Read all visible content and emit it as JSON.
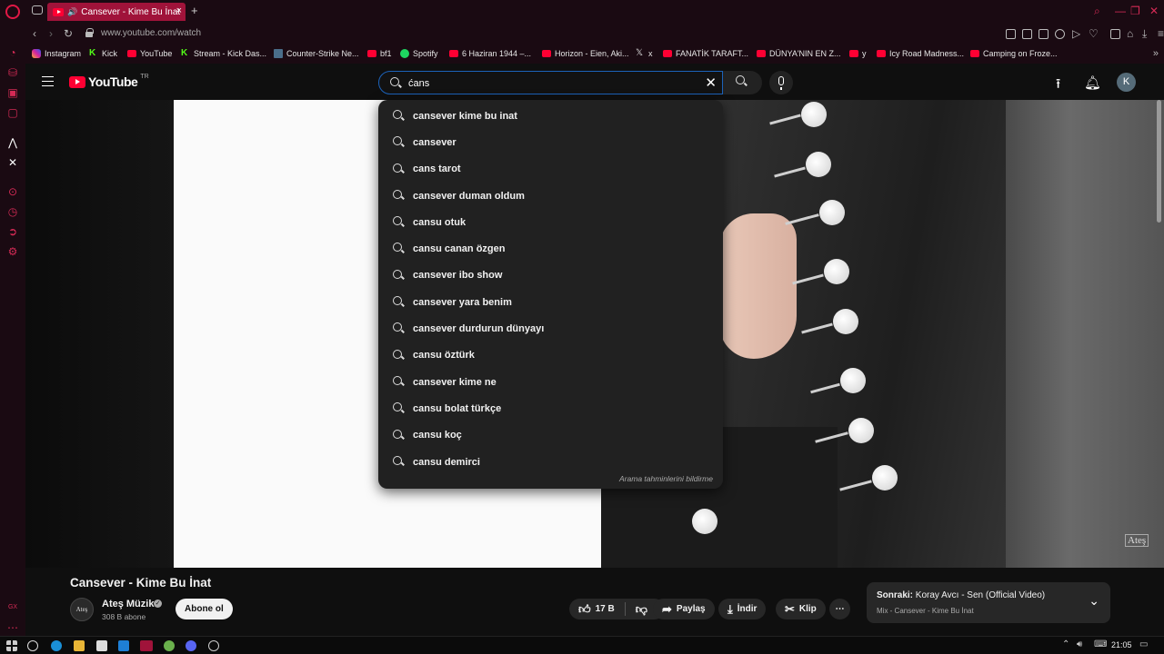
{
  "browser": {
    "tab_title": "Cansever - Kime Bu İnat",
    "new_tab": "+",
    "url": "www.youtube.com/watch"
  },
  "bookmarks": [
    {
      "label": "Instagram",
      "icon": "instagram-icon"
    },
    {
      "label": "Kick",
      "icon": "kick-icon"
    },
    {
      "label": "YouTube",
      "icon": "youtube-icon"
    },
    {
      "label": "Stream - Kick Das...",
      "icon": "kick-icon"
    },
    {
      "label": "Counter-Strike Ne...",
      "icon": "cs-icon"
    },
    {
      "label": "bf1",
      "icon": "youtube-icon"
    },
    {
      "label": "Spotify",
      "icon": "spotify-icon"
    },
    {
      "label": "6 Haziran 1944 –...",
      "icon": "youtube-icon"
    },
    {
      "label": "Horizon - Eien, Aki...",
      "icon": "youtube-icon"
    },
    {
      "label": "x",
      "icon": "x-icon"
    },
    {
      "label": "FANATİK TARAFT...",
      "icon": "youtube-icon"
    },
    {
      "label": "DÜNYA'NIN EN Z...",
      "icon": "youtube-icon"
    },
    {
      "label": "y",
      "icon": "youtube-icon"
    },
    {
      "label": "Icy Road Madness...",
      "icon": "youtube-icon"
    },
    {
      "label": "Camping on Froze...",
      "icon": "youtube-icon"
    }
  ],
  "youtube": {
    "logo_text": "YouTube",
    "region": "TR",
    "search_value": "ćans",
    "avatar_letter": "K"
  },
  "suggestions": [
    "cansever kime bu inat",
    "cansever",
    "cans tarot",
    "cansever duman oldum",
    "cansu otuk",
    "cansu canan özgen",
    "cansever ibo show",
    "cansever yara benim",
    "cansever durdurun dünyayı",
    "cansu öztürk",
    "cansever kime ne",
    "cansu bolat türkçe",
    "cansu koç",
    "cansu demirci"
  ],
  "suggest_report": "Arama tahminlerini bildirme",
  "video": {
    "watermark": "Ateş",
    "title": "Cansever - Kime Bu İnat",
    "channel_name": "Ateş Müzik",
    "channel_avatar": "Ateş",
    "subscribers": "308 B abone",
    "subscribe_label": "Abone ol",
    "likes": "17 B",
    "share_label": "Paylaş",
    "download_label": "İndir",
    "clip_label": "Klip",
    "more_label": "⋯"
  },
  "next_up": {
    "prefix": "Sonraki:",
    "title": "Koray Avcı - Sen (Official Video)",
    "subtitle": "Mix - Cansever - Kime Bu İnat"
  },
  "taskbar": {
    "time": "21:05"
  },
  "colors": {
    "opera_red": "#e01845",
    "tab_active": "#a0133a",
    "yt_red": "#ff0033",
    "search_focus": "#1c62b9"
  }
}
